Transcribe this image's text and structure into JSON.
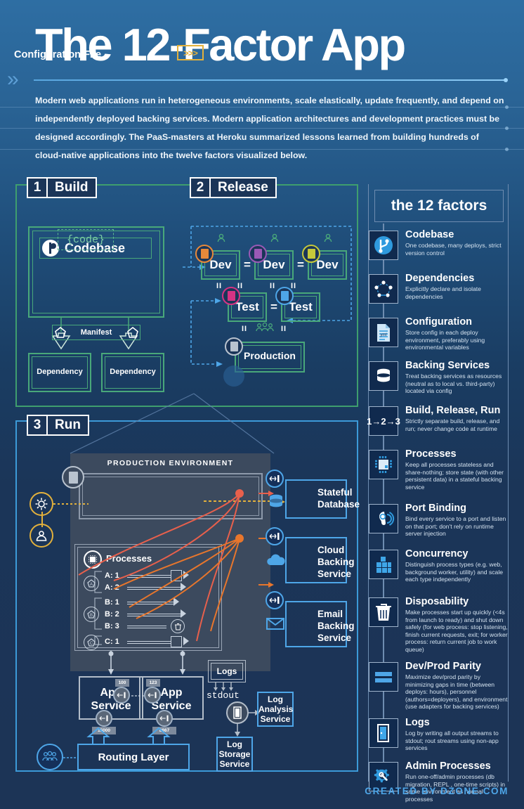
{
  "header": {
    "title": "The 12-Factor App",
    "chevron_icon": "double-chevron-right-icon",
    "body": "Modern web applications run in heterogeneous environments, scale elastically, update frequently, and depend on independently deployed backing services. Modern application architectures and development practices must be designed accordingly. The PaaS-masters at Heroku summarized lessons learned from building hundreds of cloud-native applications into the twelve factors visualized below."
  },
  "colors": {
    "bg_top": "#2e6ea3",
    "bg_bottom": "#1c3456",
    "accent_blue": "#4ea6e8",
    "green": "#49a87a",
    "yellow": "#e3b13c",
    "orange": "#e8762c",
    "red": "#e8604c",
    "panel_gray": "#3c4a5e"
  },
  "stages": {
    "build": {
      "number": "1",
      "label": "Build"
    },
    "release": {
      "number": "2",
      "label": "Release"
    },
    "run": {
      "number": "3",
      "label": "Run"
    }
  },
  "build": {
    "codebase_label": "Codebase",
    "codebase_icon": "git-branch-icon",
    "code_chip": "{code}",
    "manifest_label": "Manifest",
    "manifest_icon": "pentagon-package-icon",
    "dependencies": [
      "Dependency",
      "Dependency"
    ]
  },
  "release": {
    "dev_boxes": [
      "Dev",
      "Dev",
      "Dev"
    ],
    "test_boxes": [
      "Test",
      "Test"
    ],
    "production_label": "Production",
    "equals": [
      "=",
      "=",
      "="
    ],
    "double_bars": [
      "II",
      "II",
      "II",
      "II",
      "II",
      "II"
    ],
    "person_icon": "person-icon",
    "team_icon": "people-group-icon",
    "doc_icon": "document-icon",
    "badge_colors": [
      "#e8893a",
      "#9b59b6",
      "#c7c93a",
      "#d63384",
      "#4ea6e8",
      "#b9c3cf"
    ]
  },
  "run": {
    "production_environment_title": "PRODUCTION ENVIRONMENT",
    "config_file_label": "Configuration File",
    "config_arrow_label": ">>>",
    "gear_icon": "gear-icon",
    "user_icon": "user-icon",
    "doc_icon": "document-icon",
    "processes_title": "Processes",
    "processes_icon": "chip-icon",
    "process_groups": [
      {
        "badge": "A",
        "rows": [
          "A: 1",
          "A: 2"
        ]
      },
      {
        "badge": "B",
        "rows": [
          "B: 1",
          "B: 2",
          "B: 3"
        ]
      },
      {
        "badge": "C",
        "rows": [
          "C: 1"
        ]
      }
    ],
    "trash_icon": "trash-icon",
    "backing_services": [
      {
        "label": "Stateful\nDatabase",
        "icon": "database-icon",
        "badge_icon": "port-binding-icon"
      },
      {
        "label": "Cloud\nBacking\nService",
        "icon": "cloud-icon",
        "badge_icon": "port-binding-icon"
      },
      {
        "label": "Email\nBacking\nService",
        "icon": "envelope-icon",
        "badge_icon": "port-binding-icon"
      }
    ],
    "app_services": [
      "App\nService",
      "App\nService"
    ],
    "app_service_ports": [
      "100",
      "123"
    ],
    "app_external_ports": [
      "15000",
      "8867"
    ],
    "routing_layer_label": "Routing Layer",
    "routing_icon": "users-group-icon",
    "logs_label": "Logs",
    "stdout_label": "stdout",
    "log_door_icon": "door-icon",
    "log_analysis_label": "Log\nAnalysis\nService",
    "log_storage_label": "Log\nStorage\nService"
  },
  "sidebar": {
    "title": "the 12 factors",
    "factors": [
      {
        "name": "Codebase",
        "desc": "One codebase, many deploys, strict version control",
        "icon": "git-branch-icon"
      },
      {
        "name": "Dependencies",
        "desc": "Explicitly declare and isolate dependencies",
        "icon": "dependency-graph-icon"
      },
      {
        "name": "Configuration",
        "desc": "Store config in each deploy environment, preferably using environmental variables",
        "icon": "yml-file-icon"
      },
      {
        "name": "Backing Services",
        "desc": "Treat backing services as resources (neutral as to local vs. third-party) located via config",
        "icon": "database-icon"
      },
      {
        "name": "Build, Release, Run",
        "desc": "Strictly separate build, release, and run; never change code at runtime",
        "icon": "one-two-three-icon"
      },
      {
        "name": "Processes",
        "desc": "Keep all processes stateless and share-nothing; store state (with other persistent data) in a stateful backing service",
        "icon": "chip-icon"
      },
      {
        "name": "Port Binding",
        "desc": "Bind every service to a port and listen on that port; don't rely on runtime server injection",
        "icon": "ear-listen-icon"
      },
      {
        "name": "Concurrency",
        "desc": "Distinguish process types (e.g. web, background worker, utility) and scale each type independently",
        "icon": "building-blocks-icon"
      },
      {
        "name": "Disposability",
        "desc": "Make processes start up quickly (<4s from launch to ready) and shut down safely (for web process: stop listening, finish current requests, exit; for worker process: return current job to work queue)",
        "icon": "trash-icon"
      },
      {
        "name": "Dev/Prod Parity",
        "desc": "Maximize dev/prod parity by minimizing gaps in time (between deploys: hours), personnel (authors=deployers), and environment (use adapters for backing services)",
        "icon": "equals-bars-icon"
      },
      {
        "name": "Logs",
        "desc": "Log by writing all output streams to stdout; rout streams using non-app services",
        "icon": "door-icon"
      },
      {
        "name": "Admin Processes",
        "desc": "Run one-off/admin processes (db migration, REPL , one-time scripts) in same environment as normal processes",
        "icon": "gear-wrench-icon"
      }
    ]
  },
  "footer": {
    "credit": "CREATED BY DZONE.COM"
  }
}
